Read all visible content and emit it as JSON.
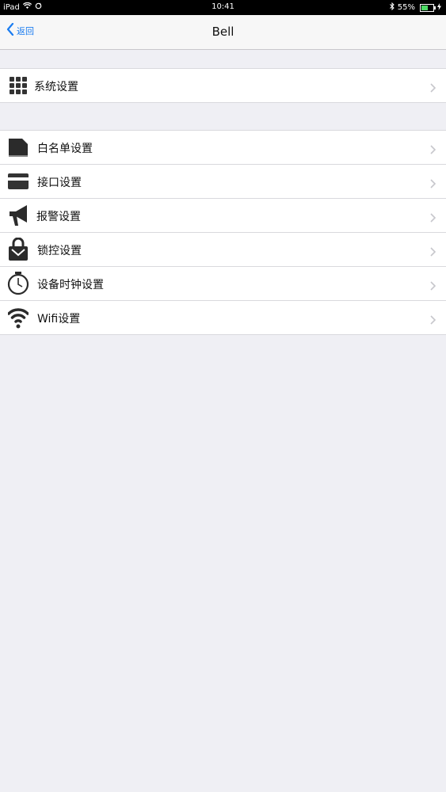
{
  "status_bar": {
    "device": "iPad",
    "time": "10:41",
    "battery": "55%",
    "battery_level": 0.55
  },
  "nav": {
    "back_label": "返回",
    "title": "Bell"
  },
  "groups": [
    {
      "items": [
        {
          "label": "系统设置",
          "icon": "grid-icon"
        }
      ]
    },
    {
      "items": [
        {
          "label": "白名单设置",
          "icon": "document-icon"
        },
        {
          "label": "接口设置",
          "icon": "card-icon"
        },
        {
          "label": "报警设置",
          "icon": "megaphone-icon"
        },
        {
          "label": "锁控设置",
          "icon": "lock-icon"
        },
        {
          "label": "设备时钟设置",
          "icon": "clock-icon"
        },
        {
          "label": "Wifi设置",
          "icon": "wifi-icon"
        }
      ]
    }
  ]
}
